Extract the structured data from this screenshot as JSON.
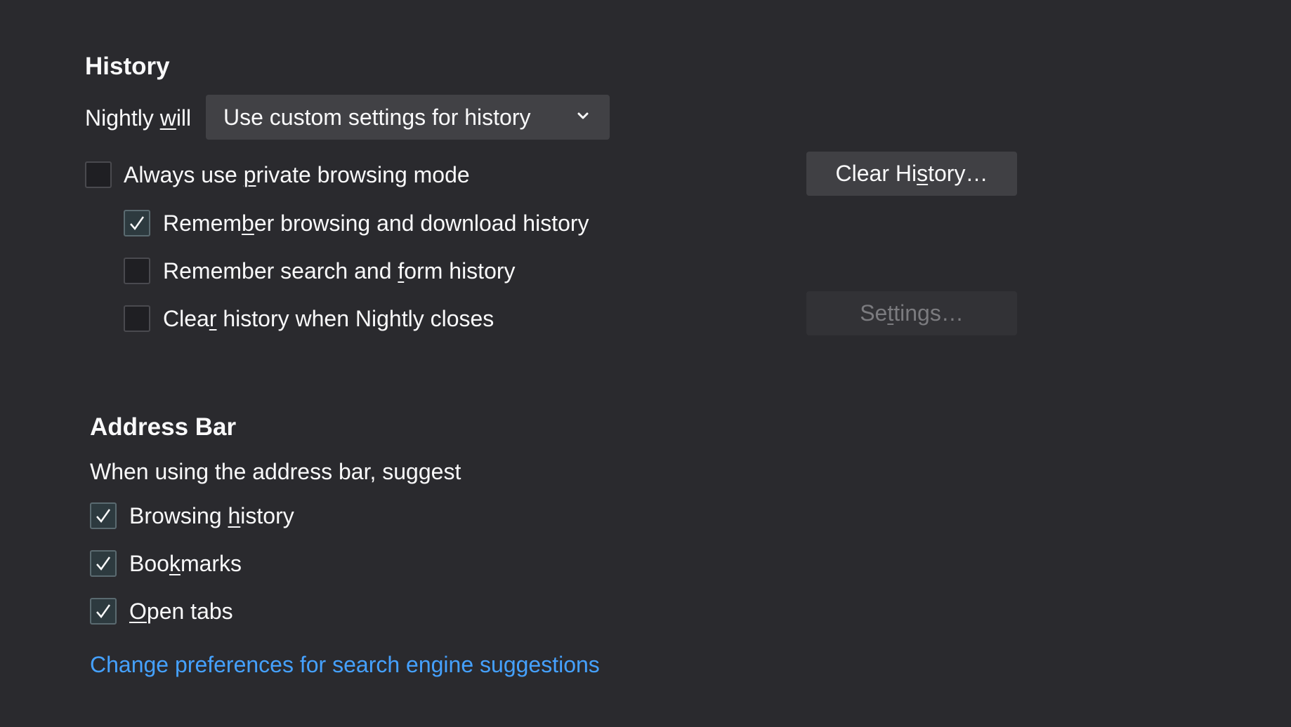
{
  "history": {
    "heading": "History",
    "nightly_will_label": [
      "Nightly ",
      "w",
      "ill"
    ],
    "mode_dropdown": {
      "selected": "Use custom settings for history",
      "icon": "chevron-down-icon"
    },
    "checkboxes": [
      {
        "pre": "Always use ",
        "key": "p",
        "post": "rivate browsing mode",
        "checked": false
      },
      {
        "pre": "Remem",
        "key": "b",
        "post": "er browsing and download history",
        "checked": true
      },
      {
        "pre": "Remember search and ",
        "key": "f",
        "post": "orm history",
        "checked": false
      },
      {
        "pre": "Clea",
        "key": "r",
        "post": " history when Nightly closes",
        "checked": false
      }
    ],
    "clear_history_button": {
      "pre": "Clear Hi",
      "key": "s",
      "post": "tory…"
    },
    "settings_button": {
      "pre": "Se",
      "key": "t",
      "post": "tings…",
      "disabled": true
    }
  },
  "address_bar": {
    "heading": "Address Bar",
    "description": "When using the address bar, suggest",
    "checkboxes": [
      {
        "pre": "Browsing ",
        "key": "h",
        "post": "istory",
        "checked": true
      },
      {
        "pre": "Boo",
        "key": "k",
        "post": "marks",
        "checked": true
      },
      {
        "pre": "",
        "key": "O",
        "post": "pen tabs",
        "checked": true
      }
    ],
    "search_suggestions_link": "Change preferences for search engine suggestions"
  },
  "colors": {
    "background": "#2a2a2e",
    "link": "#45a1ff",
    "button": "#404044"
  }
}
